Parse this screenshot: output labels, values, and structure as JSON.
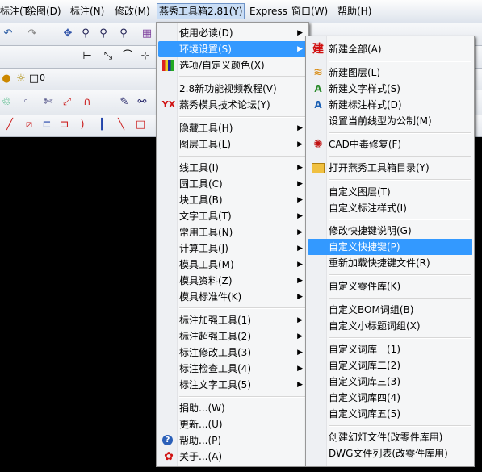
{
  "menubar": [
    {
      "label": "标注(T)",
      "active": false
    },
    {
      "label": "绘图(D)",
      "active": false
    },
    {
      "label": "标注(N)",
      "active": false
    },
    {
      "label": "修改(M)",
      "active": false
    },
    {
      "label": "燕秀工具箱2.81(Y)",
      "active": true
    },
    {
      "label": "Express",
      "active": false
    },
    {
      "label": "窗口(W)",
      "active": false
    },
    {
      "label": "帮助(H)",
      "active": false
    }
  ],
  "toolbar": {
    "style_combo_value": "andard",
    "layer_value": "0"
  },
  "menu_main": {
    "items": [
      {
        "label": "使用必读(D)",
        "submenu": true
      },
      {
        "label": "环境设置(S)",
        "submenu": true,
        "highlighted": true
      },
      {
        "label": "选项/自定义颜色(X)",
        "icon": "color-grid-icon"
      },
      {
        "sep": true
      },
      {
        "label": "2.8新功能视频教程(V)"
      },
      {
        "label": "燕秀模具技术论坛(Y)",
        "icon": "yx-logo-icon"
      },
      {
        "sep": true
      },
      {
        "label": "隐藏工具(H)",
        "submenu": true
      },
      {
        "label": "图层工具(L)",
        "submenu": true
      },
      {
        "sep": true
      },
      {
        "label": "线工具(I)",
        "submenu": true
      },
      {
        "label": "圆工具(C)",
        "submenu": true
      },
      {
        "label": "块工具(B)",
        "submenu": true
      },
      {
        "label": "文字工具(T)",
        "submenu": true
      },
      {
        "label": "常用工具(N)",
        "submenu": true
      },
      {
        "label": "计算工具(J)",
        "submenu": true
      },
      {
        "label": "模具工具(M)",
        "submenu": true
      },
      {
        "label": "模具资料(Z)",
        "submenu": true
      },
      {
        "label": "模具标准件(K)",
        "submenu": true
      },
      {
        "sep": true
      },
      {
        "label": "标注加强工具(1)",
        "submenu": true
      },
      {
        "label": "标注超强工具(2)",
        "submenu": true
      },
      {
        "label": "标注修改工具(3)",
        "submenu": true
      },
      {
        "label": "标注检查工具(4)",
        "submenu": true
      },
      {
        "label": "标注文字工具(5)",
        "submenu": true
      },
      {
        "sep": true
      },
      {
        "label": "捐助...(W)"
      },
      {
        "label": "更新...(U)"
      },
      {
        "label": "帮助...(P)",
        "icon": "help-icon"
      },
      {
        "label": "关于...(A)",
        "icon": "about-icon"
      }
    ]
  },
  "menu_sub": {
    "items": [
      {
        "label": "新建全部(A)",
        "icon": "new-all-icon"
      },
      {
        "sep": true
      },
      {
        "label": "新建图层(L)",
        "icon": "layers-icon"
      },
      {
        "label": "新建文字样式(S)",
        "icon": "text-style-icon"
      },
      {
        "label": "新建标注样式(D)",
        "icon": "dim-style-icon"
      },
      {
        "label": "设置当前线型为公制(M)"
      },
      {
        "sep": true
      },
      {
        "label": "CAD中毒修复(F)",
        "icon": "virus-fix-icon"
      },
      {
        "sep": true
      },
      {
        "label": "打开燕秀工具箱目录(Y)",
        "icon": "folder-icon"
      },
      {
        "sep": true
      },
      {
        "label": "自定义图层(T)"
      },
      {
        "label": "自定义标注样式(I)"
      },
      {
        "sep": true
      },
      {
        "label": "修改快捷键说明(G)"
      },
      {
        "label": "自定义快捷键(P)",
        "highlighted": true
      },
      {
        "label": "重新加载快捷键文件(R)"
      },
      {
        "sep": true
      },
      {
        "label": "自定义零件库(K)"
      },
      {
        "sep": true
      },
      {
        "label": "自定义BOM词组(B)"
      },
      {
        "label": "自定义小标题词组(X)"
      },
      {
        "sep": true
      },
      {
        "label": "自定义词库一(1)"
      },
      {
        "label": "自定义词库二(2)"
      },
      {
        "label": "自定义词库三(3)"
      },
      {
        "label": "自定义词库四(4)"
      },
      {
        "label": "自定义词库五(5)"
      },
      {
        "sep": true
      },
      {
        "label": "创建幻灯文件(改零件库用)"
      },
      {
        "label": "DWG文件列表(改零件库用)"
      }
    ]
  }
}
